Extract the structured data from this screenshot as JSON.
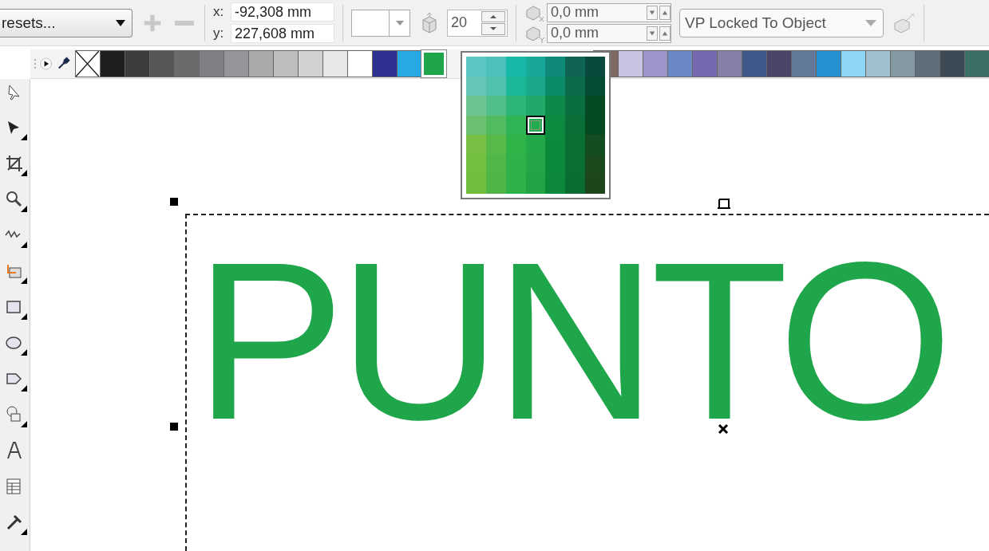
{
  "toolbar": {
    "preset_dropdown": {
      "value": "resets..."
    },
    "preset_buttons": [
      {
        "kind": "add",
        "disabled": true
      },
      {
        "kind": "remove",
        "disabled": true
      }
    ],
    "position": [
      {
        "label": "x:",
        "value": "-92,308 mm"
      },
      {
        "label": "y:",
        "value": "227,608 mm"
      }
    ],
    "depth_field": {
      "value": "20"
    },
    "offset_fields": [
      {
        "kind": "x",
        "value": "0,0 mm"
      },
      {
        "kind": "y",
        "value": "0,0 mm"
      }
    ],
    "vp_dropdown": {
      "value": "VP Locked To Object"
    }
  },
  "tools": [
    {
      "flyout": false
    },
    {
      "flyout": true
    },
    {
      "flyout": true
    },
    {
      "flyout": true
    },
    {
      "flyout": true
    },
    {
      "flyout": true
    },
    {
      "flyout": true
    },
    {
      "flyout": true
    },
    {
      "flyout": true
    },
    {
      "flyout": true
    },
    {
      "flyout": false
    },
    {
      "flyout": false
    },
    {
      "flyout": true
    }
  ],
  "palette": {
    "swatches_left": [
      {
        "kind": "none",
        "selected": false
      },
      {
        "kind": "color",
        "color": "#1e1e1e",
        "selected": false
      },
      {
        "kind": "color",
        "color": "#3c3c3c",
        "selected": false
      },
      {
        "kind": "color",
        "color": "#555657",
        "selected": false
      },
      {
        "kind": "color",
        "color": "#6a6b6d",
        "selected": false
      },
      {
        "kind": "color",
        "color": "#7f8083",
        "selected": false
      },
      {
        "kind": "color",
        "color": "#939598",
        "selected": false
      },
      {
        "kind": "color",
        "color": "#a7a9ab",
        "selected": false
      },
      {
        "kind": "color",
        "color": "#bbbdbf",
        "selected": false
      },
      {
        "kind": "color",
        "color": "#d1d2d4",
        "selected": false
      },
      {
        "kind": "color",
        "color": "#e6e7e8",
        "selected": false
      },
      {
        "kind": "color",
        "color": "#ffffff",
        "selected": false
      },
      {
        "kind": "color",
        "color": "#2e3192",
        "selected": false
      },
      {
        "kind": "color",
        "color": "#27aae1",
        "selected": false
      },
      {
        "kind": "color",
        "color": "#1fa64a",
        "selected": true
      }
    ],
    "swatches_right": [
      {
        "kind": "color",
        "color": "#7d6b63",
        "selected": false
      },
      {
        "kind": "color",
        "color": "#c7c3e0",
        "selected": false
      },
      {
        "kind": "color",
        "color": "#9b95c9",
        "selected": false
      },
      {
        "kind": "color",
        "color": "#6b88c6",
        "selected": false
      },
      {
        "kind": "color",
        "color": "#7769b0",
        "selected": false
      },
      {
        "kind": "color",
        "color": "#8480a8",
        "selected": false
      },
      {
        "kind": "color",
        "color": "#3e5a8a",
        "selected": false
      },
      {
        "kind": "color",
        "color": "#4b4668",
        "selected": false
      },
      {
        "kind": "color",
        "color": "#627a98",
        "selected": false
      },
      {
        "kind": "color",
        "color": "#2591d0",
        "selected": false
      },
      {
        "kind": "color",
        "color": "#8dd7f5",
        "selected": false
      },
      {
        "kind": "color",
        "color": "#a0c0d0",
        "selected": false
      },
      {
        "kind": "color",
        "color": "#8498a4",
        "selected": false
      },
      {
        "kind": "color",
        "color": "#5e6f7b",
        "selected": false
      },
      {
        "kind": "color",
        "color": "#3b4a54",
        "selected": false
      },
      {
        "kind": "color",
        "color": "#3b7068",
        "selected": false
      }
    ]
  },
  "shade_popup": {
    "cells": [
      {
        "color": "#5bc4c4",
        "selected": false
      },
      {
        "color": "#4cc0bc",
        "selected": false
      },
      {
        "color": "#17b8a8",
        "selected": false
      },
      {
        "color": "#17a898",
        "selected": false
      },
      {
        "color": "#0f8a7a",
        "selected": false
      },
      {
        "color": "#106454",
        "selected": false
      },
      {
        "color": "#0a4a3e",
        "selected": false
      },
      {
        "color": "#66c6b8",
        "selected": false
      },
      {
        "color": "#4fc1ac",
        "selected": false
      },
      {
        "color": "#1ab896",
        "selected": false
      },
      {
        "color": "#1aa88a",
        "selected": false
      },
      {
        "color": "#0b8a6a",
        "selected": false
      },
      {
        "color": "#0e6a4c",
        "selected": false
      },
      {
        "color": "#064c34",
        "selected": false
      },
      {
        "color": "#6cc490",
        "selected": false
      },
      {
        "color": "#52be8a",
        "selected": false
      },
      {
        "color": "#2cb678",
        "selected": false
      },
      {
        "color": "#22a868",
        "selected": false
      },
      {
        "color": "#0b8a4a",
        "selected": false
      },
      {
        "color": "#0b6e3e",
        "selected": false
      },
      {
        "color": "#064a24",
        "selected": false
      },
      {
        "color": "#6abf70",
        "selected": false
      },
      {
        "color": "#52bb62",
        "selected": false
      },
      {
        "color": "#2db556",
        "selected": false
      },
      {
        "color": "#22ac50",
        "selected": true
      },
      {
        "color": "#0b8a40",
        "selected": false
      },
      {
        "color": "#0b6e38",
        "selected": false
      },
      {
        "color": "#064a22",
        "selected": false
      },
      {
        "color": "#76bf44",
        "selected": false
      },
      {
        "color": "#56b948",
        "selected": false
      },
      {
        "color": "#2fb44a",
        "selected": false
      },
      {
        "color": "#22a848",
        "selected": false
      },
      {
        "color": "#0b8a3c",
        "selected": false
      },
      {
        "color": "#0b6e34",
        "selected": false
      },
      {
        "color": "#154d22",
        "selected": false
      },
      {
        "color": "#74be40",
        "selected": false
      },
      {
        "color": "#50b748",
        "selected": false
      },
      {
        "color": "#2db34a",
        "selected": false
      },
      {
        "color": "#22a646",
        "selected": false
      },
      {
        "color": "#0b8a3c",
        "selected": false
      },
      {
        "color": "#0b6e34",
        "selected": false
      },
      {
        "color": "#1b4a1e",
        "selected": false
      },
      {
        "color": "#72bc3e",
        "selected": false
      },
      {
        "color": "#4eb546",
        "selected": false
      },
      {
        "color": "#2db24a",
        "selected": false
      },
      {
        "color": "#22a444",
        "selected": false
      },
      {
        "color": "#0b883a",
        "selected": false
      },
      {
        "color": "#0b6c32",
        "selected": false
      },
      {
        "color": "#1e461c",
        "selected": false
      }
    ]
  },
  "canvas": {
    "text": "PUNTO"
  }
}
